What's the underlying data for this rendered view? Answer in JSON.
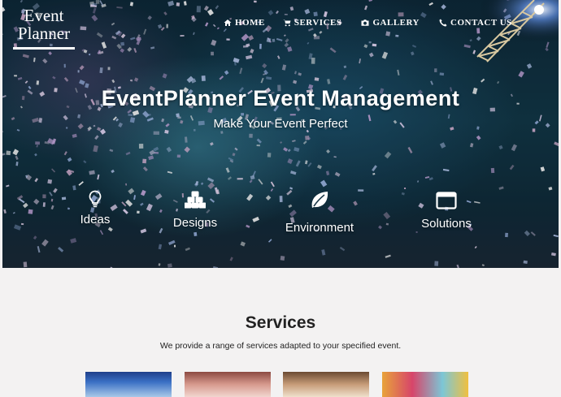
{
  "brand": {
    "line1": "Event",
    "line2": "Planner"
  },
  "nav": {
    "items": [
      {
        "label": "HOME",
        "icon": "home-icon"
      },
      {
        "label": "SERVICES",
        "icon": "cart-icon"
      },
      {
        "label": "GALLERY",
        "icon": "camera-icon"
      },
      {
        "label": "CONTACT US",
        "icon": "phone-icon"
      }
    ]
  },
  "hero": {
    "title": "EventPlanner Event Management",
    "subtitle": "Make Your Event Perfect",
    "features": [
      {
        "label": "Ideas",
        "icon": "lightbulb-icon"
      },
      {
        "label": "Designs",
        "icon": "blocks-icon"
      },
      {
        "label": "Environment",
        "icon": "leaf-icon"
      },
      {
        "label": "Solutions",
        "icon": "window-icon"
      }
    ]
  },
  "services": {
    "title": "Services",
    "description": "We provide a range of services adapted to your specified event."
  }
}
